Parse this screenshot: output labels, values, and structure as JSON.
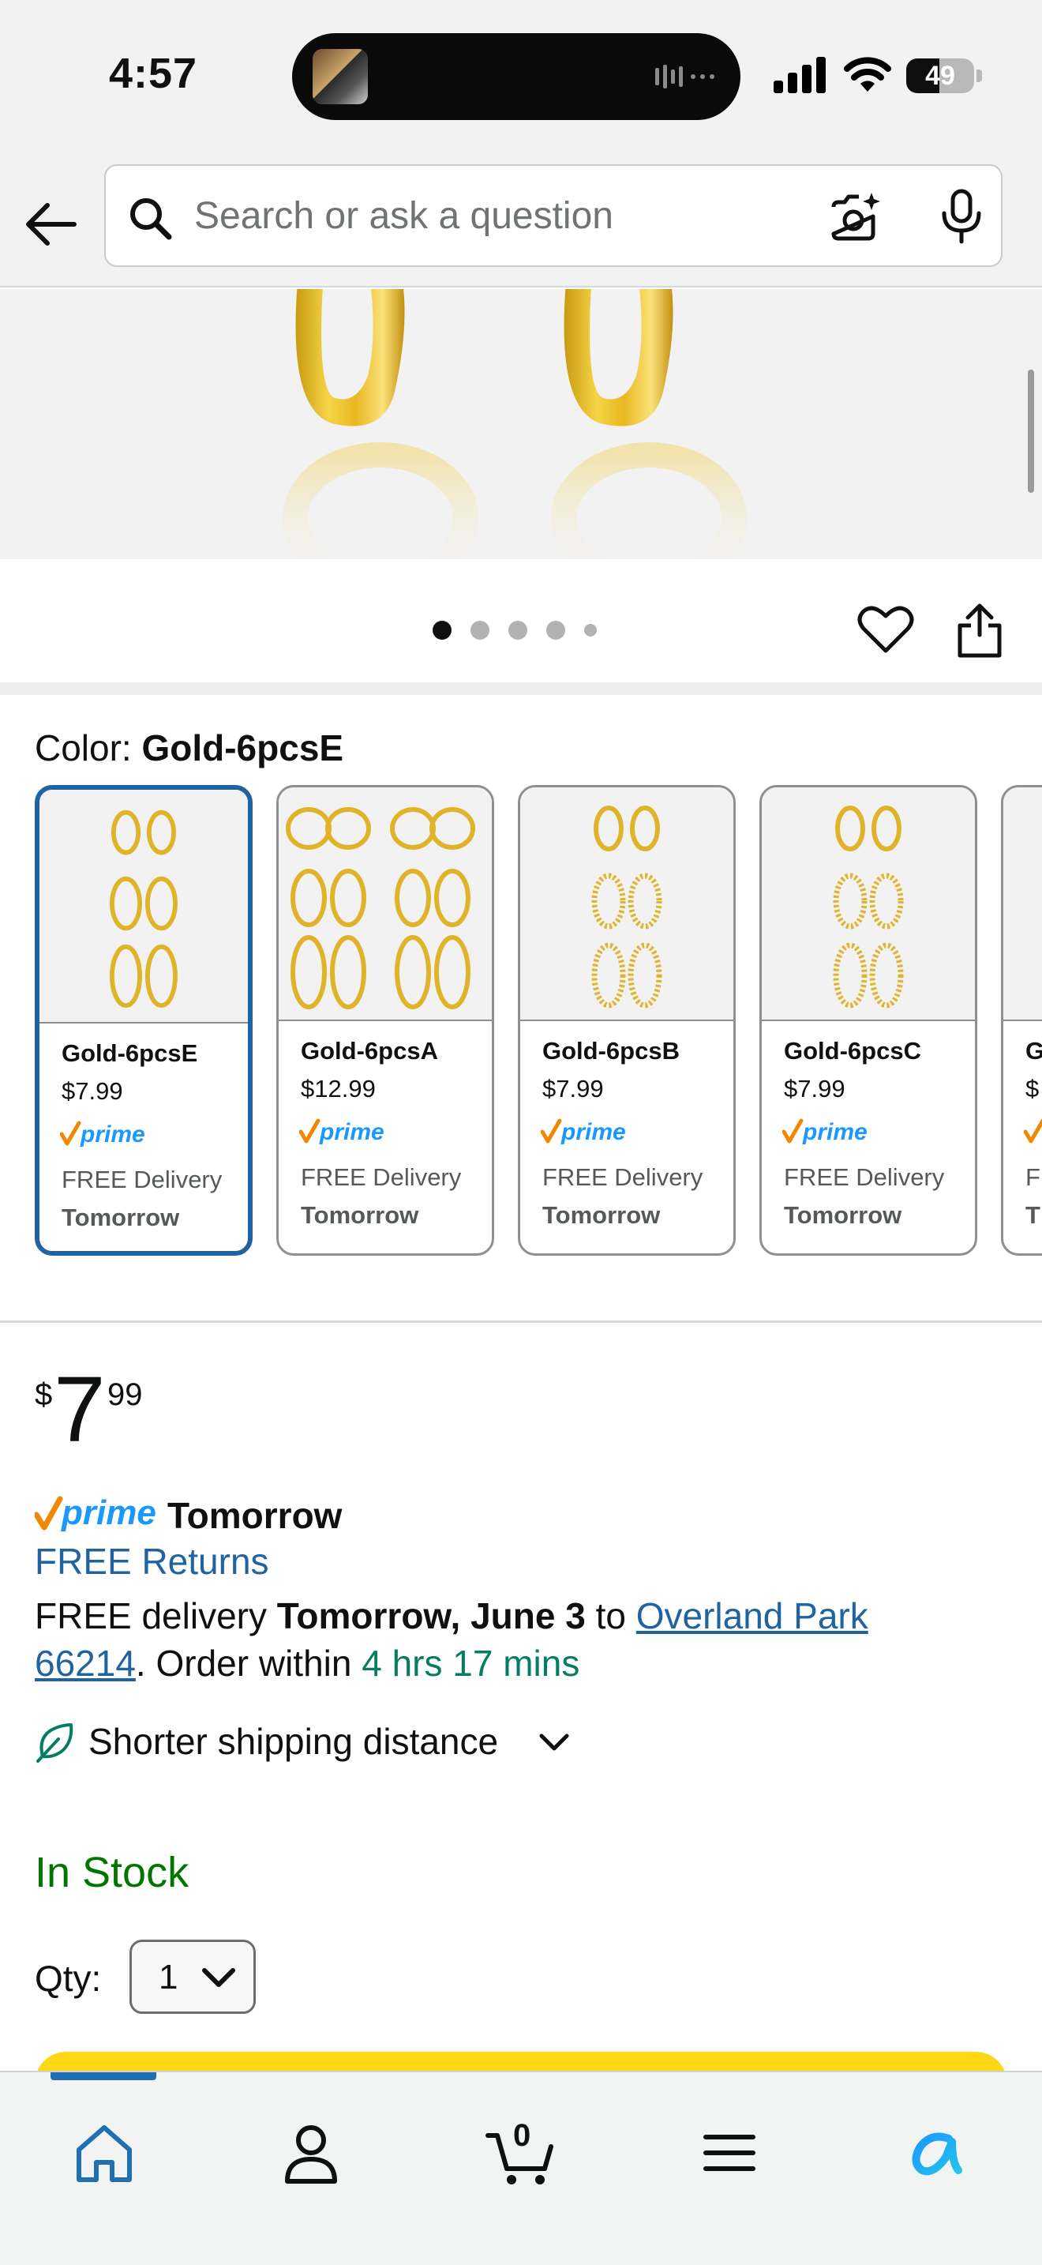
{
  "status_bar": {
    "time": "4:57",
    "battery": "49",
    "battery_level": 0.49
  },
  "search": {
    "placeholder": "Search or ask a question",
    "value": ""
  },
  "product_images": {
    "count": 5,
    "active_index": 0
  },
  "color": {
    "label": "Color: ",
    "selected": "Gold-6pcsE"
  },
  "swatches": [
    {
      "name": "Gold-6pcsE",
      "price": "$7.99",
      "delivery": "FREE Delivery",
      "day": "Tomorrow",
      "selected": true
    },
    {
      "name": "Gold-6pcsA",
      "price": "$12.99",
      "delivery": "FREE Delivery",
      "day": "Tomorrow",
      "selected": false
    },
    {
      "name": "Gold-6pcsB",
      "price": "$7.99",
      "delivery": "FREE Delivery",
      "day": "Tomorrow",
      "selected": false
    },
    {
      "name": "Gold-6pcsC",
      "price": "$7.99",
      "delivery": "FREE Delivery",
      "day": "Tomorrow",
      "selected": false
    },
    {
      "name": "G",
      "price": "$",
      "delivery": "F",
      "day": "T",
      "selected": false
    }
  ],
  "price": {
    "symbol": "$",
    "whole": "7",
    "fraction": "99"
  },
  "prime": {
    "badge": "prime",
    "day": "Tomorrow"
  },
  "returns": "FREE Returns",
  "delivery": {
    "prefix": "FREE delivery ",
    "date": "Tomorrow, June 3",
    "to": " to ",
    "location": "Overland Park 66214",
    "order_within": ". Order within ",
    "countdown": "4 hrs 17 mins"
  },
  "shipping_note": "Shorter shipping distance",
  "stock": "In Stock",
  "qty": {
    "label": "Qty:",
    "value": "1"
  },
  "nav": {
    "cart_count": "0"
  },
  "colors": {
    "link": "#2162a1",
    "in_stock": "#007600",
    "countdown": "#067d62",
    "selected_border": "#2162a1",
    "buy_button": "#ffd814",
    "prime_blue": "#1a98ff",
    "prime_check": "#f08804"
  },
  "icons": [
    "back-arrow-icon",
    "search-icon",
    "camera-icon",
    "mic-icon",
    "heart-icon",
    "share-icon",
    "leaf-icon",
    "chevron-down-icon",
    "home-icon",
    "account-icon",
    "cart-icon",
    "menu-icon",
    "rufus-icon"
  ]
}
